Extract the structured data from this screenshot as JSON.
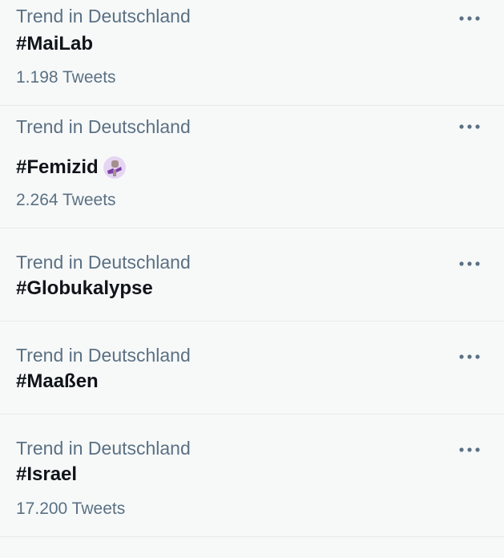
{
  "trends": [
    {
      "context": "Trend in Deutschland",
      "name": "#MaiLab",
      "count": "1.198 Tweets",
      "has_emoji": false
    },
    {
      "context": "Trend in Deutschland",
      "name": "#Femizid",
      "count": "2.264 Tweets",
      "has_emoji": true,
      "emoji_icon": "purple-ribbon-fist-icon"
    },
    {
      "context": "Trend in Deutschland",
      "name": "#Globukalypse",
      "has_emoji": false
    },
    {
      "context": "Trend in Deutschland",
      "name": "#Maaßen",
      "has_emoji": false
    },
    {
      "context": "Trend in Deutschland",
      "name": "#Israel",
      "count": "17.200 Tweets",
      "has_emoji": false
    }
  ],
  "more_icon": "more-horizontal-icon",
  "colors": {
    "background": "#f7f9f9",
    "secondary_text": "#5b7083",
    "primary_text": "#0f1419",
    "divider": "#e6e9eb"
  }
}
